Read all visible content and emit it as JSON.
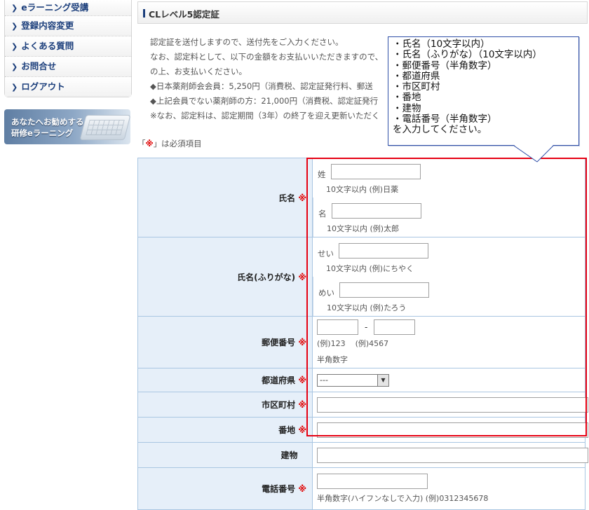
{
  "sidebar": {
    "items": [
      {
        "label": "eラーニング受講"
      },
      {
        "label": "登録内容変更"
      },
      {
        "label": "よくある質問"
      },
      {
        "label": "お問合せ"
      },
      {
        "label": "ログアウト"
      }
    ],
    "banner": {
      "line1": "あなたへお勧めする",
      "line2": "研修eラーニング"
    }
  },
  "page": {
    "title": "CLレベル5認定証"
  },
  "intro": {
    "lines": [
      "認定証を送付しますので、送付先をご入力ください。",
      "なお、認定料として、以下の金額をお支払いいただきますので、",
      "の上、お支払いください。",
      "◆日本薬剤師会会員：5,250円（消費税、認定証発行料、郵送",
      "◆上記会員でない薬剤師の方：21,000円（消費税、認定証発行",
      "※なお、認定料は、認定期間（3年）の終了を迎え更新いただく"
    ]
  },
  "required_note": {
    "open": "「",
    "mark": "※",
    "rest": "」は必須項目"
  },
  "form": {
    "required_mark": "※",
    "name": {
      "label": "氏名",
      "sei_prefix": "姓",
      "sei_hint": "10文字以内 (例)日薬",
      "mei_prefix": "名",
      "mei_hint": "10文字以内 (例)太郎"
    },
    "kana": {
      "label": "氏名(ふりがな)",
      "sei_prefix": "せい",
      "sei_hint": "10文字以内 (例)にちやく",
      "mei_prefix": "めい",
      "mei_hint": "10文字以内 (例)たろう"
    },
    "zip": {
      "label": "郵便番号",
      "separator": "-",
      "hint1": "(例)123",
      "hint2": "(例)4567",
      "hint3": "半角数字"
    },
    "prefecture": {
      "label": "都道府県",
      "selected": "---"
    },
    "city": {
      "label": "市区町村"
    },
    "address": {
      "label": "番地"
    },
    "building": {
      "label": "建物"
    },
    "phone": {
      "label": "電話番号",
      "hint": "半角数字(ハイフンなしで入力) (例)0312345678"
    }
  },
  "tooltip": {
    "lines": [
      "・氏名（10文字以内）",
      "・氏名（ふりがな）（10文字以内）",
      "・郵便番号（半角数字）",
      "・都道府県",
      "・市区町村",
      "・番地",
      "・建物",
      "・電話番号（半角数字）",
      "を入力してください。"
    ]
  },
  "colors": {
    "accent": "#1c3f7c",
    "required": "#e00000",
    "highlight": "#e60012",
    "tooltip_border": "#3050a8",
    "label_bg": "#e6eff9"
  }
}
